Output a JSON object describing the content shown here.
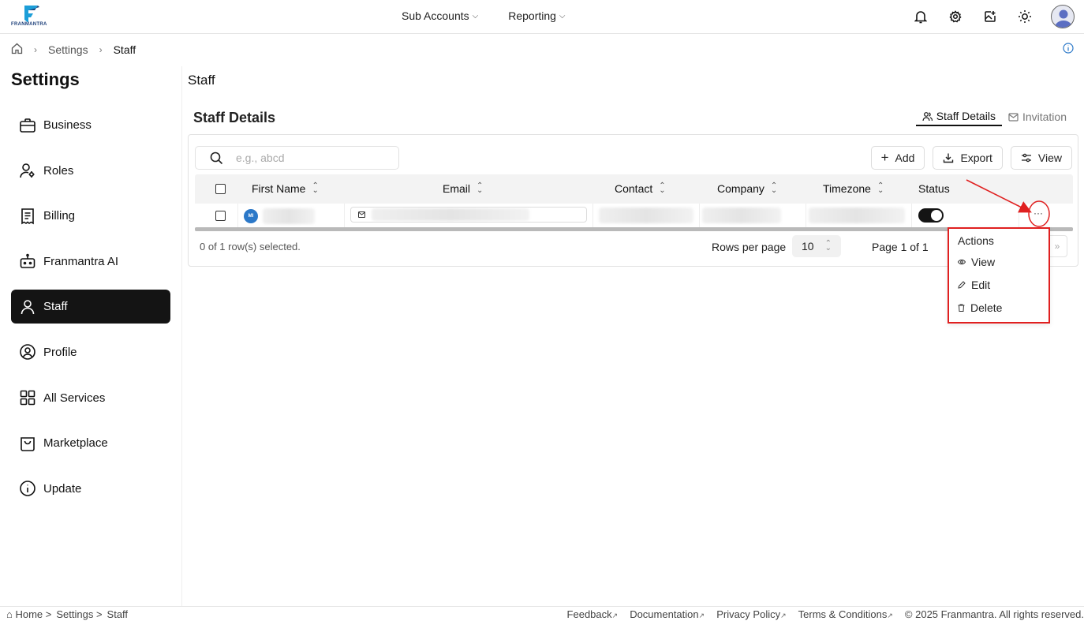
{
  "brand": {
    "name": "FRANMANTRA",
    "accent": "#1c9ed8",
    "dark": "#141414"
  },
  "topnav": {
    "items": [
      {
        "label": "Sub Accounts"
      },
      {
        "label": "Reporting"
      }
    ],
    "icons": [
      "bell-icon",
      "gear-icon",
      "image-edit-icon",
      "sun-icon",
      "avatar"
    ]
  },
  "breadcrumb": {
    "items": [
      "Settings",
      "Staff"
    ]
  },
  "sidebar": {
    "title": "Settings",
    "items": [
      {
        "label": "Business",
        "icon": "briefcase-icon"
      },
      {
        "label": "Roles",
        "icon": "user-key-icon"
      },
      {
        "label": "Billing",
        "icon": "receipt-icon"
      },
      {
        "label": "Franmantra AI",
        "icon": "bot-icon"
      },
      {
        "label": "Staff",
        "icon": "user-icon",
        "active": true
      },
      {
        "label": "Profile",
        "icon": "user-circle-icon"
      },
      {
        "label": "All Services",
        "icon": "grid-icon"
      },
      {
        "label": "Marketplace",
        "icon": "shopping-bag-icon"
      },
      {
        "label": "Update",
        "icon": "info-icon"
      }
    ]
  },
  "main": {
    "page_title": "Staff",
    "section_title": "Staff Details",
    "tabs": [
      {
        "label": "Staff Details",
        "active": true
      },
      {
        "label": "Invitation",
        "active": false
      }
    ],
    "search": {
      "placeholder": "e.g., abcd",
      "value": ""
    },
    "toolbar": {
      "add_label": "Add",
      "export_label": "Export",
      "view_label": "View"
    },
    "table": {
      "columns": [
        "First Name",
        "Email",
        "Contact",
        "Company",
        "Timezone",
        "Status"
      ],
      "rows": [
        {
          "initials": "MI",
          "status_on": true
        }
      ]
    },
    "footer": {
      "selected_text": "0 of 1 row(s) selected.",
      "rows_per_page_label": "Rows per page",
      "rows_per_page_value": "10",
      "page_info": "Page 1 of 1"
    },
    "actions_menu": {
      "title": "Actions",
      "items": [
        {
          "label": "View",
          "icon": "eye-icon"
        },
        {
          "label": "Edit",
          "icon": "pencil-icon"
        },
        {
          "label": "Delete",
          "icon": "trash-icon"
        }
      ]
    }
  },
  "bottombar": {
    "breadcrumb": [
      "⌂ Home >",
      "Settings >",
      "Staff"
    ],
    "links": [
      "Feedback",
      "Documentation",
      "Privacy Policy",
      "Terms & Conditions"
    ],
    "copyright": "© 2025 Franmantra. All rights reserved."
  },
  "annotation_color": "#e02020"
}
